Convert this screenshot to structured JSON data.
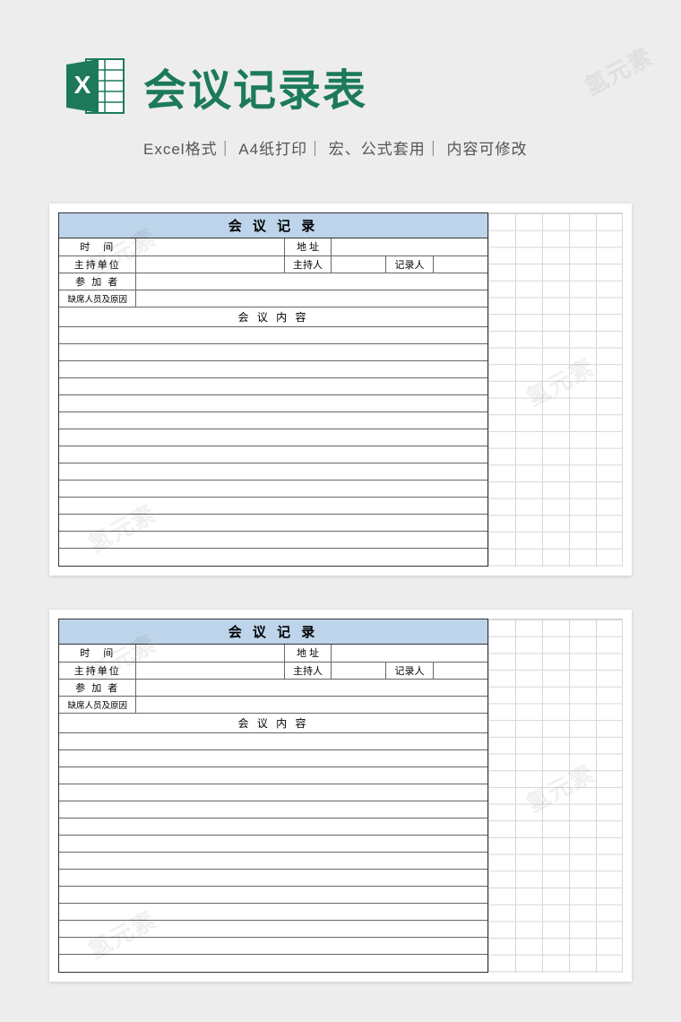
{
  "header": {
    "main_title": "会议记录表",
    "subtitle": "Excel格式｜ A4纸打印｜ 宏、公式套用｜ 内容可修改",
    "icon_letter": "X"
  },
  "form": {
    "title": "会 议 记 录",
    "labels": {
      "time": "时　间",
      "address": "地 址",
      "host_unit": "主持单位",
      "host": "主持人",
      "recorder": "记录人",
      "attendees": "参 加 者",
      "absent": "缺席人员及原因",
      "content": "会 议 内 容"
    },
    "values": {
      "time": "",
      "address": "",
      "host_unit": "",
      "host": "",
      "recorder": "",
      "attendees": "",
      "absent": ""
    }
  },
  "watermark": "氢元素"
}
